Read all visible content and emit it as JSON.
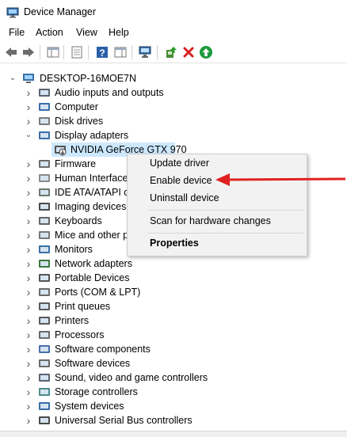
{
  "window": {
    "title": "Device Manager"
  },
  "menu": [
    "File",
    "Action",
    "View",
    "Help"
  ],
  "tree": {
    "root": "DESKTOP-16MOE7N",
    "items": [
      {
        "label": "Audio inputs and outputs",
        "icon": "speaker-icon",
        "state": "collapsed"
      },
      {
        "label": "Computer",
        "icon": "computer-icon",
        "state": "collapsed"
      },
      {
        "label": "Disk drives",
        "icon": "disk-icon",
        "state": "collapsed"
      },
      {
        "label": "Display adapters",
        "icon": "monitor-icon",
        "state": "expanded"
      },
      {
        "label": "NVIDIA GeForce GTX 970",
        "icon": "display-adapter-disabled-icon",
        "state": "child",
        "selected": true
      },
      {
        "label": "Firmware",
        "icon": "chip-icon",
        "state": "collapsed"
      },
      {
        "label": "Human Interface",
        "icon": "hid-icon",
        "state": "collapsed"
      },
      {
        "label": "IDE ATA/ATAPI c",
        "icon": "ide-icon",
        "state": "collapsed"
      },
      {
        "label": "Imaging devices",
        "icon": "camera-icon",
        "state": "collapsed"
      },
      {
        "label": "Keyboards",
        "icon": "keyboard-icon",
        "state": "collapsed"
      },
      {
        "label": "Mice and other p",
        "icon": "mouse-icon",
        "state": "collapsed"
      },
      {
        "label": "Monitors",
        "icon": "monitor-icon",
        "state": "collapsed"
      },
      {
        "label": "Network adapters",
        "icon": "network-icon",
        "state": "collapsed"
      },
      {
        "label": "Portable Devices",
        "icon": "portable-device-icon",
        "state": "collapsed"
      },
      {
        "label": "Ports (COM & LPT)",
        "icon": "port-icon",
        "state": "collapsed"
      },
      {
        "label": "Print queues",
        "icon": "printer-icon",
        "state": "collapsed"
      },
      {
        "label": "Printers",
        "icon": "printer-icon",
        "state": "collapsed"
      },
      {
        "label": "Processors",
        "icon": "processor-icon",
        "state": "collapsed"
      },
      {
        "label": "Software components",
        "icon": "software-component-icon",
        "state": "collapsed"
      },
      {
        "label": "Software devices",
        "icon": "software-device-icon",
        "state": "collapsed"
      },
      {
        "label": "Sound, video and game controllers",
        "icon": "speaker-icon",
        "state": "collapsed"
      },
      {
        "label": "Storage controllers",
        "icon": "storage-icon",
        "state": "collapsed"
      },
      {
        "label": "System devices",
        "icon": "system-device-icon",
        "state": "collapsed"
      },
      {
        "label": "Universal Serial Bus controllers",
        "icon": "usb-icon",
        "state": "collapsed"
      }
    ]
  },
  "context_menu": {
    "update": "Update driver",
    "enable": "Enable device",
    "uninstall": "Uninstall device",
    "scan": "Scan for hardware changes",
    "properties": "Properties"
  },
  "colors": {
    "selection": "#cce8ff",
    "arrow": "#e02020",
    "accent": "#1e73be"
  }
}
